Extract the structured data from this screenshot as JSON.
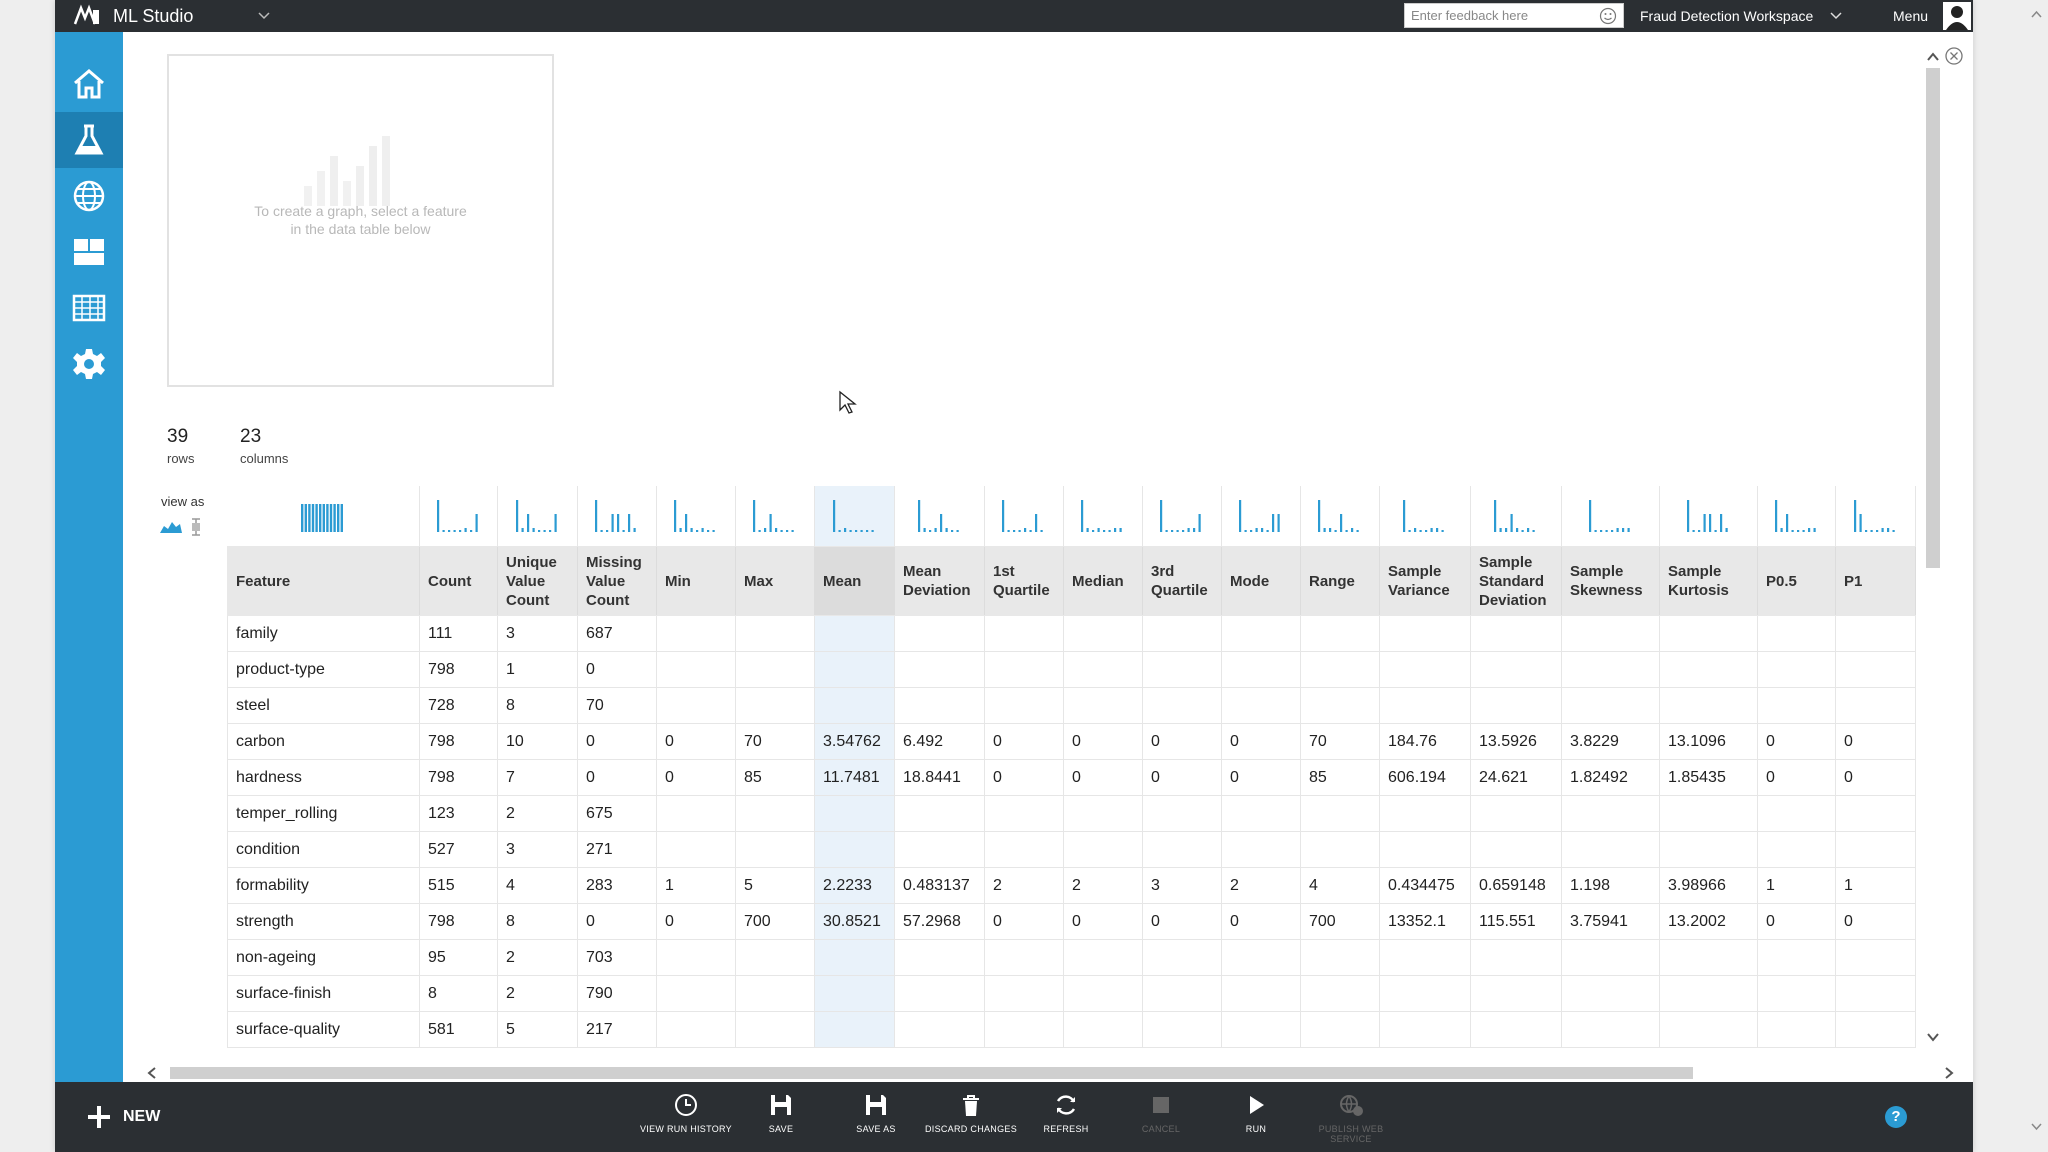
{
  "topbar": {
    "app_title": "ML Studio",
    "feedback_placeholder": "Enter feedback here",
    "workspace": "Fraud Detection Workspace",
    "menu_label": "Menu"
  },
  "colors": {
    "topbar": "#2b2f33",
    "nav": "#2b9bd3",
    "nav_active": "#1e7fb2",
    "bottombar": "#2b2f33",
    "selected_column": "#e9f2fa"
  },
  "nav_items": [
    "home-icon",
    "flask-icon",
    "globe-icon",
    "dashboard-icon",
    "grid-icon",
    "gear-icon"
  ],
  "preview": {
    "hint": "To create a graph, select a feature\nin the data table below"
  },
  "stats": {
    "rows_value": "39",
    "rows_label": "rows",
    "columns_value": "23",
    "columns_label": "columns"
  },
  "view_as_label": "view as",
  "table": {
    "headers": [
      "Feature",
      "Count",
      "Unique Value Count",
      "Missing Value Count",
      "Min",
      "Max",
      "Mean",
      "Mean Deviation",
      "1st Quartile",
      "Median",
      "3rd Quartile",
      "Mode",
      "Range",
      "Sample Variance",
      "Sample Standard Deviation",
      "Sample Skewness",
      "Sample Kurtosis",
      "P0.5",
      "P1"
    ],
    "selected_column": 6,
    "rows": [
      [
        "family",
        "111",
        "3",
        "687",
        "",
        "",
        "",
        "",
        "",
        "",
        "",
        "",
        "",
        "",
        "",
        "",
        "",
        "",
        ""
      ],
      [
        "product-type",
        "798",
        "1",
        "0",
        "",
        "",
        "",
        "",
        "",
        "",
        "",
        "",
        "",
        "",
        "",
        "",
        "",
        "",
        ""
      ],
      [
        "steel",
        "728",
        "8",
        "70",
        "",
        "",
        "",
        "",
        "",
        "",
        "",
        "",
        "",
        "",
        "",
        "",
        "",
        "",
        ""
      ],
      [
        "carbon",
        "798",
        "10",
        "0",
        "0",
        "70",
        "3.54762",
        "6.492",
        "0",
        "0",
        "0",
        "0",
        "70",
        "184.76",
        "13.5926",
        "3.8229",
        "13.1096",
        "0",
        "0"
      ],
      [
        "hardness",
        "798",
        "7",
        "0",
        "0",
        "85",
        "11.7481",
        "18.8441",
        "0",
        "0",
        "0",
        "0",
        "85",
        "606.194",
        "24.621",
        "1.82492",
        "1.85435",
        "0",
        "0"
      ],
      [
        "temper_rolling",
        "123",
        "2",
        "675",
        "",
        "",
        "",
        "",
        "",
        "",
        "",
        "",
        "",
        "",
        "",
        "",
        "",
        "",
        ""
      ],
      [
        "condition",
        "527",
        "3",
        "271",
        "",
        "",
        "",
        "",
        "",
        "",
        "",
        "",
        "",
        "",
        "",
        "",
        "",
        "",
        ""
      ],
      [
        "formability",
        "515",
        "4",
        "283",
        "1",
        "5",
        "2.2233",
        "0.483137",
        "2",
        "2",
        "3",
        "2",
        "4",
        "0.434475",
        "0.659148",
        "1.198",
        "3.98966",
        "1",
        "1"
      ],
      [
        "strength",
        "798",
        "8",
        "0",
        "0",
        "700",
        "30.8521",
        "57.2968",
        "0",
        "0",
        "0",
        "0",
        "700",
        "13352.1",
        "115.551",
        "3.75941",
        "13.2002",
        "0",
        "0"
      ],
      [
        "non-ageing",
        "95",
        "2",
        "703",
        "",
        "",
        "",
        "",
        "",
        "",
        "",
        "",
        "",
        "",
        "",
        "",
        "",
        "",
        ""
      ],
      [
        "surface-finish",
        "8",
        "2",
        "790",
        "",
        "",
        "",
        "",
        "",
        "",
        "",
        "",
        "",
        "",
        "",
        "",
        "",
        "",
        ""
      ],
      [
        "surface-quality",
        "581",
        "5",
        "217",
        "",
        "",
        "",
        "",
        "",
        "",
        "",
        "",
        "",
        "",
        "",
        "",
        "",
        "",
        ""
      ]
    ]
  },
  "toolbar": {
    "new_label": "NEW",
    "buttons": [
      {
        "label": "VIEW RUN HISTORY",
        "icon": "clock-icon"
      },
      {
        "label": "SAVE",
        "icon": "save-icon"
      },
      {
        "label": "SAVE AS",
        "icon": "save-as-icon"
      },
      {
        "label": "DISCARD CHANGES",
        "icon": "trash-icon"
      },
      {
        "label": "REFRESH",
        "icon": "refresh-icon"
      },
      {
        "label": "CANCEL",
        "icon": "stop-icon"
      },
      {
        "label": "RUN",
        "icon": "play-icon"
      },
      {
        "label": "PUBLISH WEB SERVICE",
        "icon": "publish-icon"
      }
    ],
    "help_label": "?"
  }
}
